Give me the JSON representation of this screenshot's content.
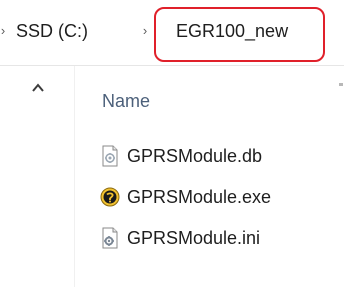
{
  "breadcrumb": {
    "items": [
      {
        "label": "SSD (C:)"
      },
      {
        "label": "EGR100_new"
      }
    ]
  },
  "file_list": {
    "column_name": "Name",
    "files": [
      {
        "name": "GPRSModule.db",
        "icon": "database-file-icon"
      },
      {
        "name": "GPRSModule.exe",
        "icon": "application-exe-icon"
      },
      {
        "name": "GPRSModule.ini",
        "icon": "settings-file-icon"
      }
    ]
  },
  "colors": {
    "highlight": "#e0202a",
    "header_text": "#4c607a"
  }
}
